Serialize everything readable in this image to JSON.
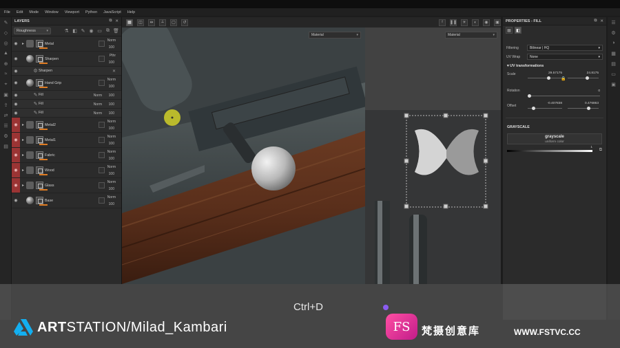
{
  "menubar": {
    "items": [
      "File",
      "Edit",
      "Mode",
      "Window",
      "Viewport",
      "Python",
      "JavaScript",
      "Help"
    ]
  },
  "layers": {
    "title": "LAYERS",
    "channel": "Roughness",
    "rows": [
      {
        "name": "Metal",
        "blend": "Norm",
        "opacity": "100",
        "type": "folder",
        "red": false
      },
      {
        "name": "Sharpen",
        "blend": "Pthr",
        "opacity": "100",
        "type": "fill",
        "red": false
      },
      {
        "name": "Sharpen",
        "blend": "",
        "opacity": "",
        "type": "effect",
        "red": false
      },
      {
        "name": "Hand Grip",
        "blend": "Norm",
        "opacity": "100",
        "type": "fill",
        "red": false
      },
      {
        "name": "Fill",
        "blend": "Norm",
        "opacity": "100",
        "type": "subfill",
        "red": false
      },
      {
        "name": "Fill",
        "blend": "Norm",
        "opacity": "100",
        "type": "subfill",
        "red": false
      },
      {
        "name": "Fill",
        "blend": "Norm",
        "opacity": "100",
        "type": "subfill",
        "red": false
      },
      {
        "name": "Metal2",
        "blend": "Norm",
        "opacity": "100",
        "type": "folder",
        "red": true
      },
      {
        "name": "Metal1",
        "blend": "Norm",
        "opacity": "100",
        "type": "folder",
        "red": true
      },
      {
        "name": "Fabric",
        "blend": "Norm",
        "opacity": "100",
        "type": "folder",
        "red": true
      },
      {
        "name": "Wood",
        "blend": "Norm",
        "opacity": "100",
        "type": "folder",
        "red": true
      },
      {
        "name": "Glass",
        "blend": "Norm",
        "opacity": "100",
        "type": "folder",
        "red": true
      },
      {
        "name": "Base",
        "blend": "Norm",
        "opacity": "100",
        "type": "fill",
        "red": false
      }
    ]
  },
  "viewport": {
    "material_left": "Material",
    "material_right": "Material"
  },
  "properties": {
    "title": "PROPERTIES - FILL",
    "filtering_label": "Filtering",
    "filtering_value": "Bilinear | HQ",
    "uvwrap_label": "UV Wrap",
    "uvwrap_value": "None",
    "uv_section": "UV transformations",
    "scale_label": "Scale",
    "scale_x": "29.57175",
    "scale_y": "24.8175",
    "rotation_label": "Rotation",
    "rotation_value": "0",
    "offset_label": "Offset",
    "offset_x": "-0.407838",
    "offset_y": "0.476863",
    "grayscale_section": "GRAYSCALE",
    "grayscale_name": "grayscale",
    "grayscale_sub": "uniform color",
    "grayscale_value": "1"
  },
  "overlay": {
    "shortcut": "Ctrl+D",
    "brand_bold": "ART",
    "brand_rest": "STATION/Milad_Kambari",
    "fs_logo": "FS",
    "cn_text": "梵摄创意库",
    "url": "WWW.FSTVC.CC"
  }
}
